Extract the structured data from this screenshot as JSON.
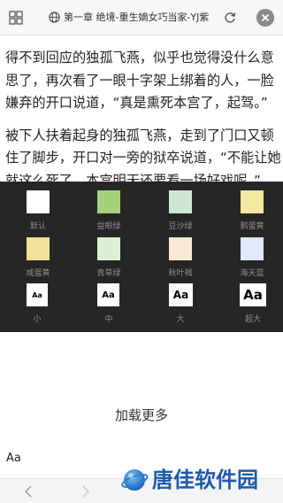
{
  "topbar": {
    "title": "第一章 绝境-重生嫡女巧当家-YJ紫",
    "icons": [
      "grid-icon",
      "globe-icon",
      "refresh-icon",
      "close-icon"
    ]
  },
  "article": {
    "paragraphs": [
      "得不到回应的独孤飞燕，似乎也觉得没什么意思了，再次看了一眼十字架上绑着的人，一脸嫌弃的开口说道，“真是熏死本宫了，起驾。”",
      "被下人扶着起身的独孤飞燕，走到了门口又顿住了脚步，开口对一旁的狱卒说道，“不能让她就这么死了，本宫明天还要看一场好戏呢。”"
    ]
  },
  "settings": {
    "themes": [
      {
        "label": "默认",
        "color": "#ffffff"
      },
      {
        "label": "益眼绿",
        "color": "#a3d27a"
      },
      {
        "label": "豆沙绿",
        "color": "#cde7d2"
      },
      {
        "label": "鹅蛋黄",
        "color": "#f1e9a0"
      },
      {
        "label": "咸蛋黄",
        "color": "#efe29b"
      },
      {
        "label": "青草绿",
        "color": "#dcefd3"
      },
      {
        "label": "秋叶褐",
        "color": "#f8e9d6"
      },
      {
        "label": "海天蓝",
        "color": "#e2e7fb"
      }
    ],
    "font_sizes": [
      {
        "glyph": "Aa",
        "label": "小"
      },
      {
        "glyph": "Aa",
        "label": "中"
      },
      {
        "glyph": "Aa",
        "label": "大"
      },
      {
        "glyph": "Aa",
        "label": "超大"
      }
    ]
  },
  "load_more": "加载更多",
  "font_toggle": "Aa",
  "bottom_nav": {
    "icons": [
      "back-arrow-icon",
      "forward-arrow-icon"
    ]
  },
  "watermark": {
    "text": "唐佳软件园",
    "color": "#1d5aa8"
  }
}
